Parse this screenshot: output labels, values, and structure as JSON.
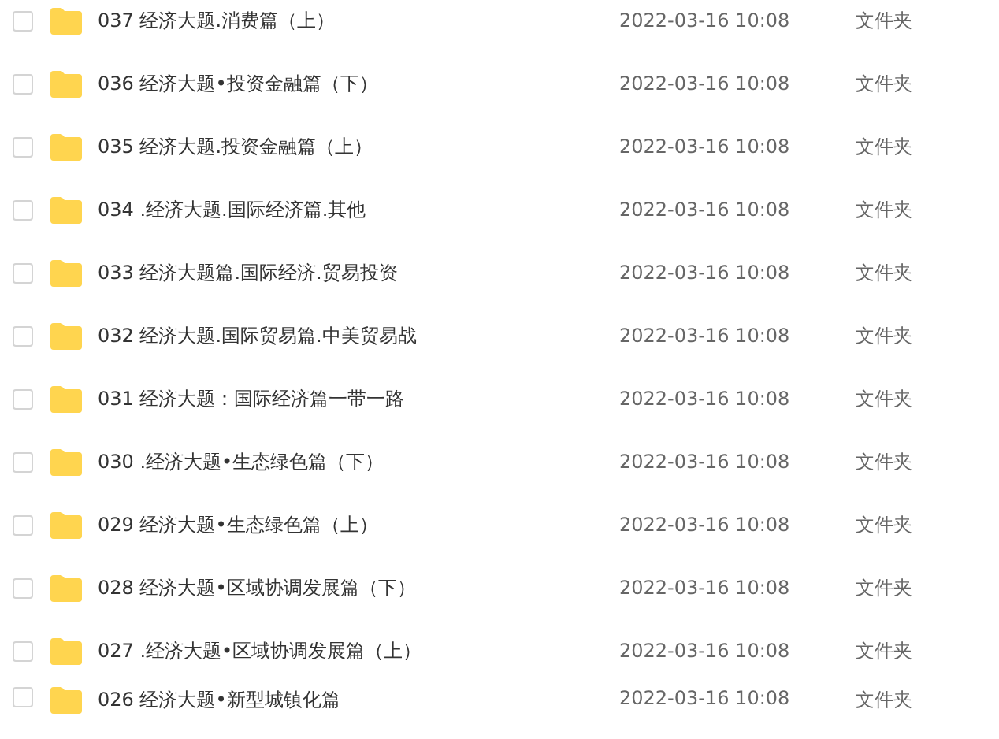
{
  "files": [
    {
      "name": "037 经济大题.消费篇（上）",
      "modified": "2022-03-16 10:08",
      "type": "文件夹",
      "checked": false
    },
    {
      "name": "036 经济大题•投资金融篇（下）",
      "modified": "2022-03-16 10:08",
      "type": "文件夹",
      "checked": false
    },
    {
      "name": "035 经济大题.投资金融篇（上）",
      "modified": "2022-03-16 10:08",
      "type": "文件夹",
      "checked": false
    },
    {
      "name": "034 .经济大题.国际经济篇.其他",
      "modified": "2022-03-16 10:08",
      "type": "文件夹",
      "checked": false
    },
    {
      "name": "033 经济大题篇.国际经济.贸易投资",
      "modified": "2022-03-16 10:08",
      "type": "文件夹",
      "checked": false
    },
    {
      "name": "032 经济大题.国际贸易篇.中美贸易战",
      "modified": "2022-03-16 10:08",
      "type": "文件夹",
      "checked": false
    },
    {
      "name": "031 经济大题：国际经济篇一带一路",
      "modified": "2022-03-16 10:08",
      "type": "文件夹",
      "checked": false
    },
    {
      "name": "030 .经济大题•生态绿色篇（下）",
      "modified": "2022-03-16 10:08",
      "type": "文件夹",
      "checked": false
    },
    {
      "name": "029 经济大题•生态绿色篇（上）",
      "modified": "2022-03-16 10:08",
      "type": "文件夹",
      "checked": false
    },
    {
      "name": "028 经济大题•区域协调发展篇（下）",
      "modified": "2022-03-16 10:08",
      "type": "文件夹",
      "checked": false
    },
    {
      "name": "027 .经济大题•区域协调发展篇（上）",
      "modified": "2022-03-16 10:08",
      "type": "文件夹",
      "checked": false
    },
    {
      "name": "026 经济大题•新型城镇化篇",
      "modified": "2022-03-16 10:08",
      "type": "文件夹",
      "checked": false
    }
  ]
}
